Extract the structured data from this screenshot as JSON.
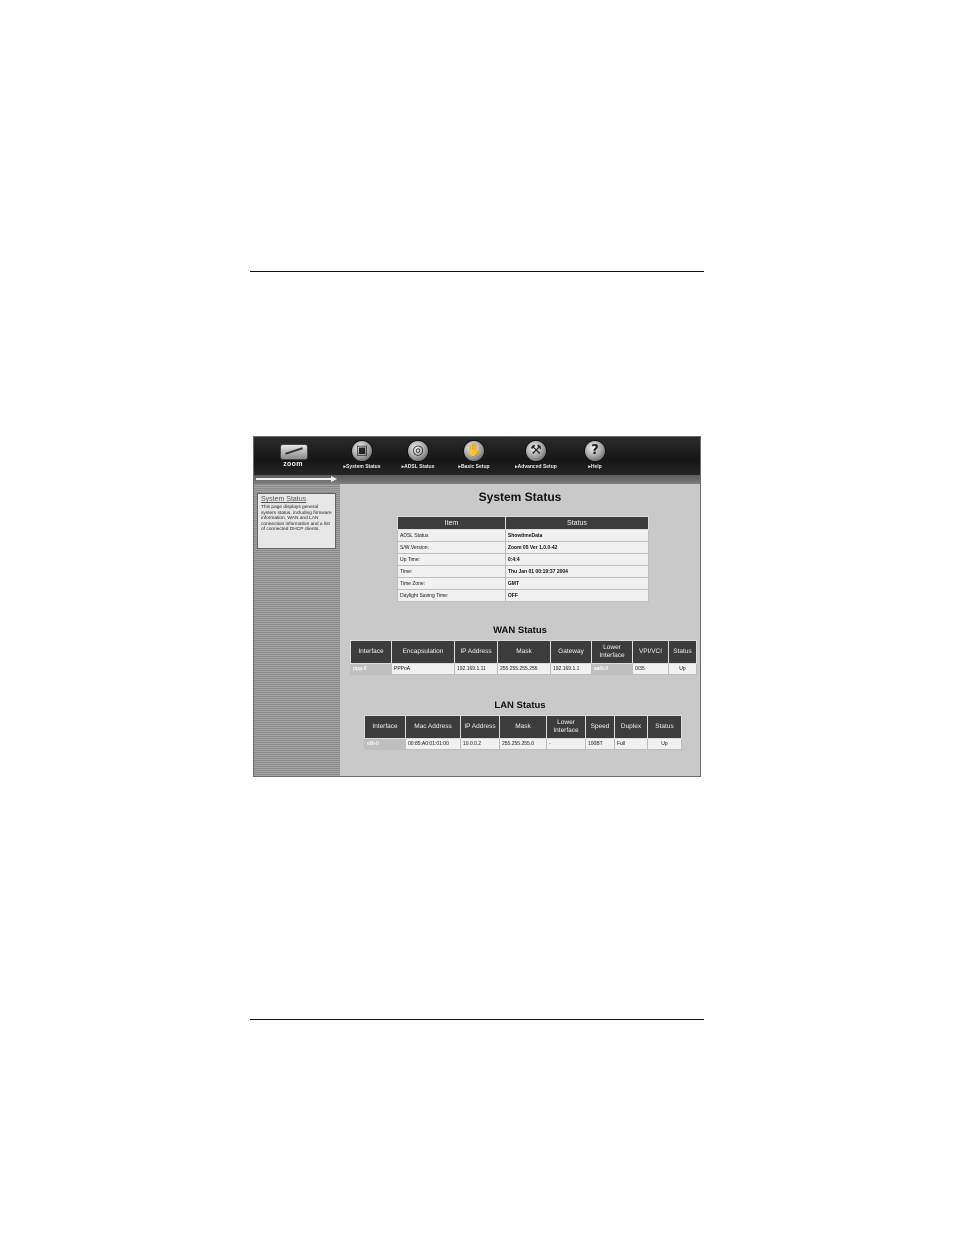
{
  "header": {
    "logo_text": "zoom",
    "nav": [
      {
        "label": "System Status",
        "icon": "globe-monitor-icon",
        "glyph": "▣"
      },
      {
        "label": "ADSL Status",
        "icon": "magnifier-icon",
        "glyph": "◎"
      },
      {
        "label": "Basic Setup",
        "icon": "hand-icon",
        "glyph": "✋"
      },
      {
        "label": "Advanced Setup",
        "icon": "wrench-icon",
        "glyph": "⚒"
      },
      {
        "label": "Help",
        "icon": "question-icon",
        "glyph": "?"
      }
    ]
  },
  "sidebar": {
    "title": "System Status",
    "description": "This page displays general system status, including firmware information, WAN and LAN connection information and a list of connected DHCP clients."
  },
  "system_status": {
    "title": "System Status",
    "headers": [
      "Item",
      "Status"
    ],
    "rows": [
      [
        "ADSL Status",
        "ShowtimeData"
      ],
      [
        "S/W Version:",
        "Zoom 05 Ver 1.0.0-42"
      ],
      [
        "Up Time:",
        "0:4:4"
      ],
      [
        "Time:",
        "Thu Jan 01 00:19:37 2004"
      ],
      [
        "Time Zone:",
        "GMT"
      ],
      [
        "Daylight Saving Time:",
        "OFF"
      ]
    ]
  },
  "wan_status": {
    "title": "WAN Status",
    "headers": [
      "Interface",
      "Encapsulation",
      "IP Address",
      "Mask",
      "Gateway",
      "Lower Interface",
      "VPI/VCI",
      "Status"
    ],
    "rows": [
      [
        "ppp-0",
        "PPPoA",
        "192.169.1.11",
        "255.255.255.255",
        "192.169.1.1",
        "aal5-0",
        "0/35",
        "Up"
      ]
    ]
  },
  "lan_status": {
    "title": "LAN Status",
    "headers": [
      "Interface",
      "Mac Address",
      "IP Address",
      "Mask",
      "Lower Interface",
      "Speed",
      "Duplex",
      "Status"
    ],
    "rows": [
      [
        "eth-0",
        "00:85:A0:01:01:00",
        "10.0.0.2",
        "255.255.255.0",
        "-",
        "100BT",
        "Full",
        "Up"
      ]
    ]
  }
}
